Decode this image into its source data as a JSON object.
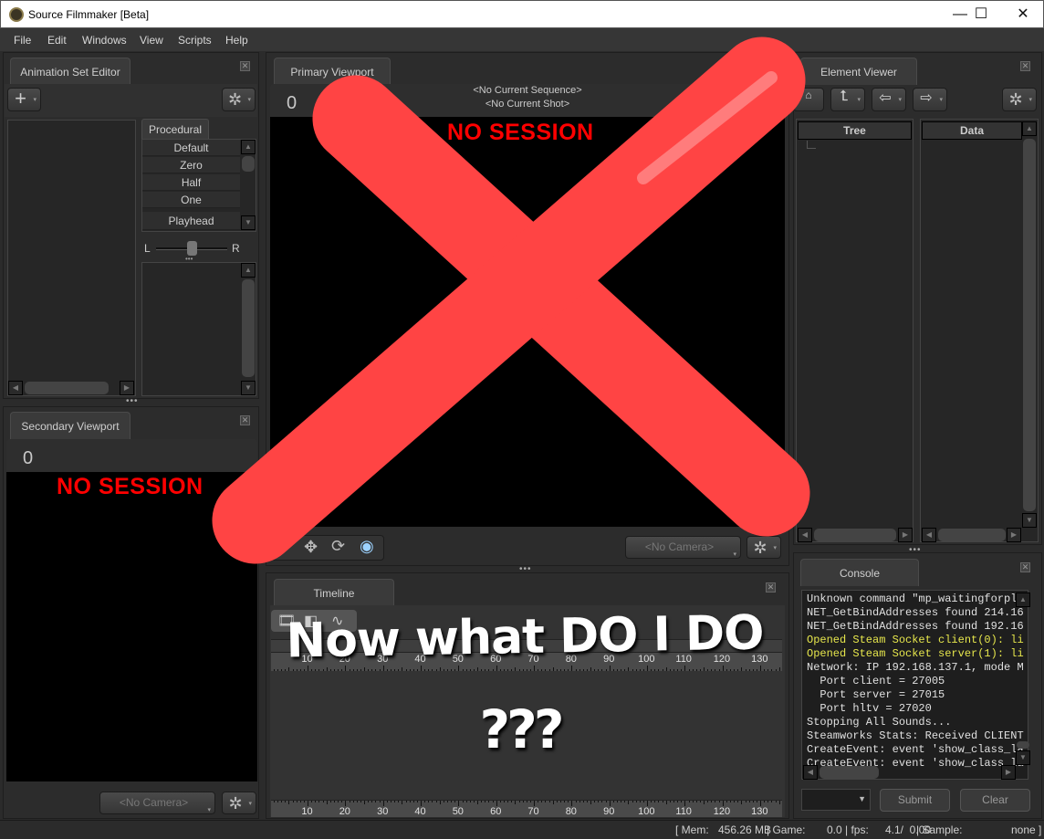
{
  "window": {
    "title": "Source Filmmaker [Beta]",
    "controls": {
      "minimize": "—",
      "maximize": "☐",
      "close": "✕"
    }
  },
  "menu": [
    "File",
    "Edit",
    "Windows",
    "View",
    "Scripts",
    "Help"
  ],
  "animation_set_editor": {
    "tab_label": "Animation Set Editor",
    "add_icon": "+",
    "gear_icon": "✲",
    "procedural_tab": "Procedural",
    "procedural_items": [
      "Default",
      "Zero",
      "Half",
      "One",
      "Playhead"
    ],
    "balance_left": "L",
    "balance_right": "R",
    "balance_value": 0.5
  },
  "secondary_viewport": {
    "tab_label": "Secondary Viewport",
    "frame": "0",
    "overlay": "NO SESSION",
    "camera_select": "<No Camera>"
  },
  "primary_viewport": {
    "tab_label": "Primary Viewport",
    "frame": "0",
    "sequence": "<No Current Sequence>",
    "shot": "<No Current Shot>",
    "overlay": "NO SESSION",
    "camera_select": "<No Camera>"
  },
  "element_viewer": {
    "tab_label": "Element Viewer",
    "col_tree": "Tree",
    "col_data": "Data"
  },
  "timeline": {
    "tab_label": "Timeline",
    "ticks": [
      "10",
      "20",
      "30",
      "40",
      "50",
      "60",
      "70",
      "80",
      "90",
      "100",
      "110",
      "120",
      "130"
    ],
    "top_ticks_visible": [
      "20",
      "30",
      "40",
      "50",
      "60",
      "70",
      "80",
      "100",
      "110",
      "130"
    ]
  },
  "console": {
    "tab_label": "Console",
    "lines": [
      {
        "text": "Unknown command \"mp_waitingforpla",
        "color": "white"
      },
      {
        "text": "NET_GetBindAddresses found 214.16",
        "color": "white"
      },
      {
        "text": "NET_GetBindAddresses found 192.16",
        "color": "white"
      },
      {
        "text": "Opened Steam Socket client(0): li",
        "color": "yellow"
      },
      {
        "text": "Opened Steam Socket server(1): li",
        "color": "yellow"
      },
      {
        "text": "Network: IP 192.168.137.1, mode M",
        "color": "white"
      },
      {
        "text": "  Port client = 27005",
        "color": "white"
      },
      {
        "text": "  Port server = 27015",
        "color": "white"
      },
      {
        "text": "  Port hltv = 27020",
        "color": "white"
      },
      {
        "text": "Stopping All Sounds...",
        "color": "white"
      },
      {
        "text": "Steamworks Stats: Received CLIENT",
        "color": "white"
      },
      {
        "text": "CreateEvent: event 'show_class_la",
        "color": "white"
      },
      {
        "text": "CreateEvent: event 'show_class_la",
        "color": "white"
      }
    ],
    "input_value": "",
    "submit_label": "Submit",
    "clear_label": "Clear"
  },
  "status_bar": {
    "mem_label": "[ Mem:",
    "mem_value": "456.26 MB",
    "game_label": "| Game:",
    "game_value": "0.0",
    "fps_label": "| fps:",
    "fps_value": "4.1/  0.00",
    "sample_label": "| Sample:",
    "sample_value": "none ]"
  },
  "meme_overlay": {
    "caption": "Now what DO I DO",
    "question": "???",
    "x_color": "#ff4444"
  }
}
